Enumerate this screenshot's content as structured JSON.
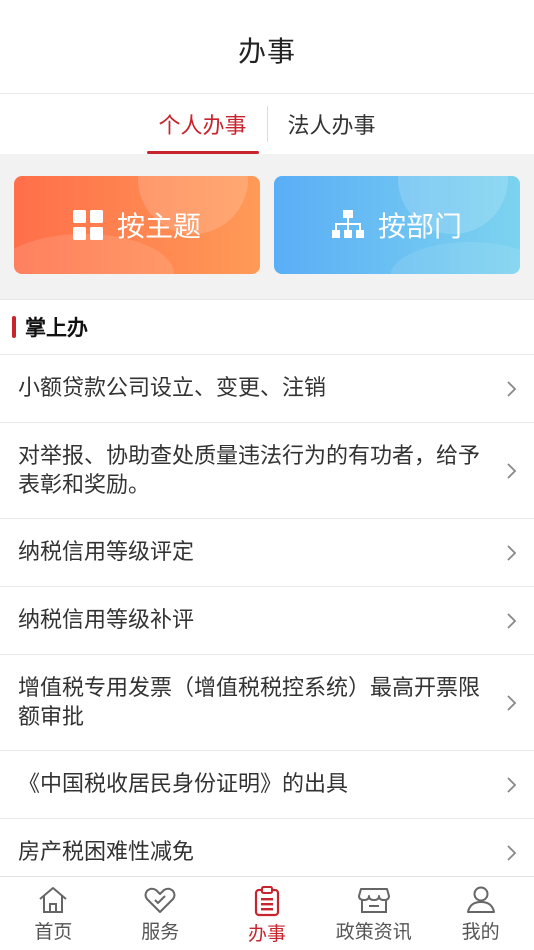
{
  "header": {
    "title": "办事"
  },
  "tabs": [
    {
      "label": "个人办事",
      "active": true
    },
    {
      "label": "法人办事",
      "active": false
    }
  ],
  "cards": {
    "topic": {
      "label": "按主题",
      "icon": "grid-icon",
      "color": "#ff7a4d"
    },
    "dept": {
      "label": "按部门",
      "icon": "org-chart-icon",
      "color": "#63b8f3"
    }
  },
  "section": {
    "title": "掌上办"
  },
  "items": [
    {
      "text": "小额贷款公司设立、变更、注销"
    },
    {
      "text": "对举报、协助查处质量违法行为的有功者，给予表彰和奖励。"
    },
    {
      "text": "纳税信用等级评定"
    },
    {
      "text": "纳税信用等级补评"
    },
    {
      "text": "增值税专用发票（增值税税控系统）最高开票限额审批"
    },
    {
      "text": "《中国税收居民身份证明》的出具"
    },
    {
      "text": "房产税困难性减免"
    }
  ],
  "nav": [
    {
      "label": "首页",
      "icon": "home-icon"
    },
    {
      "label": "服务",
      "icon": "service-tag-icon"
    },
    {
      "label": "办事",
      "icon": "clipboard-icon",
      "active": true
    },
    {
      "label": "政策资讯",
      "icon": "store-icon"
    },
    {
      "label": "我的",
      "icon": "user-icon"
    }
  ],
  "colors": {
    "accent": "#c8242d"
  }
}
